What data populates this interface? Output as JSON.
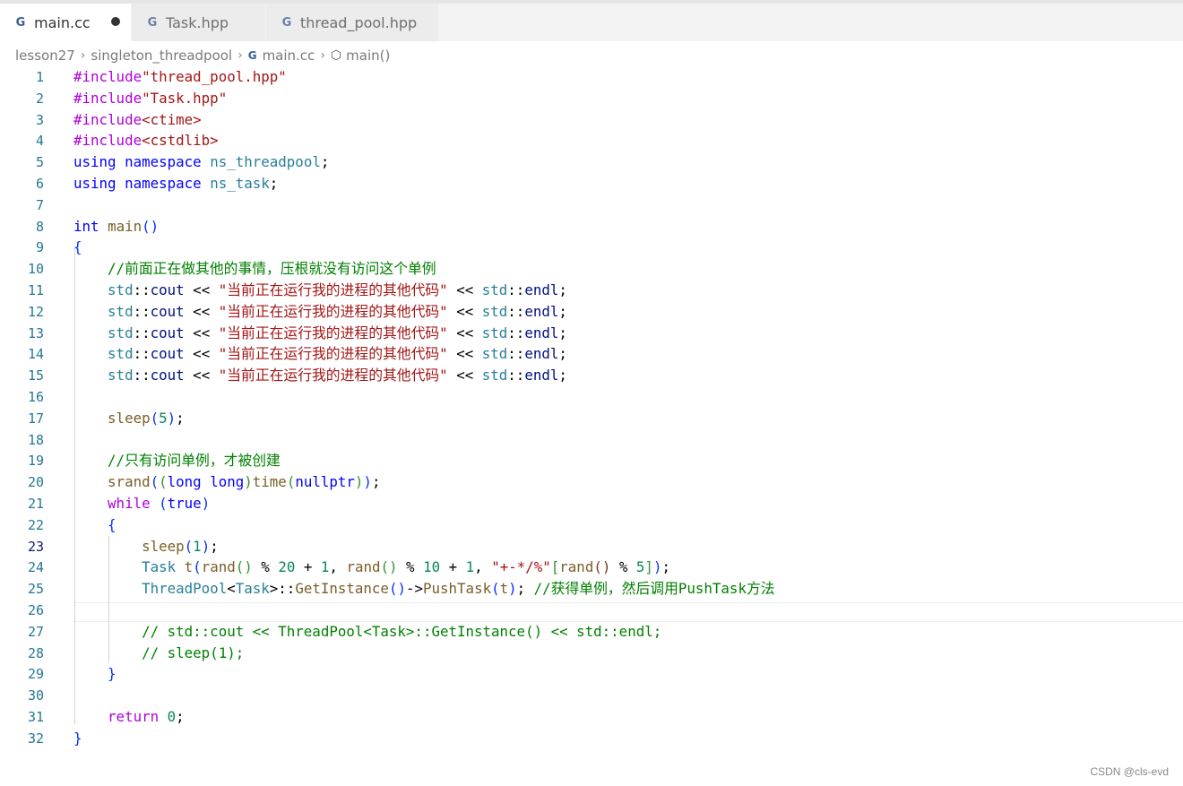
{
  "tabs": [
    {
      "label": "main.cc",
      "active": true,
      "modified": true,
      "icon": "cpp-file-icon"
    },
    {
      "label": "Task.hpp",
      "active": false,
      "modified": false,
      "icon": "cpp-file-icon"
    },
    {
      "label": "thread_pool.hpp",
      "active": false,
      "modified": false,
      "icon": "cpp-file-icon"
    }
  ],
  "breadcrumb": {
    "items": [
      "lesson27",
      "singleton_threadpool",
      "main.cc",
      "main()"
    ],
    "file_icon": "C",
    "symbol_icon": "cube-icon"
  },
  "editor": {
    "current_line": 23,
    "lines": [
      {
        "n": "1",
        "text": "#include\"thread_pool.hpp\""
      },
      {
        "n": "2",
        "text": "#include\"Task.hpp\""
      },
      {
        "n": "3",
        "text": "#include<ctime>"
      },
      {
        "n": "4",
        "text": "#include<cstdlib>"
      },
      {
        "n": "5",
        "text": "using namespace ns_threadpool;"
      },
      {
        "n": "6",
        "text": "using namespace ns_task;"
      },
      {
        "n": "7",
        "text": ""
      },
      {
        "n": "8",
        "text": "int main()"
      },
      {
        "n": "9",
        "text": "{"
      },
      {
        "n": "10",
        "text": "    //前面正在做其他的事情，压根就没有访问这个单例"
      },
      {
        "n": "11",
        "text": "    std::cout << \"当前正在运行我的进程的其他代码\" << std::endl;"
      },
      {
        "n": "12",
        "text": "    std::cout << \"当前正在运行我的进程的其他代码\" << std::endl;"
      },
      {
        "n": "13",
        "text": "    std::cout << \"当前正在运行我的进程的其他代码\" << std::endl;"
      },
      {
        "n": "14",
        "text": "    std::cout << \"当前正在运行我的进程的其他代码\" << std::endl;"
      },
      {
        "n": "15",
        "text": "    std::cout << \"当前正在运行我的进程的其他代码\" << std::endl;"
      },
      {
        "n": "16",
        "text": ""
      },
      {
        "n": "17",
        "text": "    sleep(5);"
      },
      {
        "n": "18",
        "text": ""
      },
      {
        "n": "19",
        "text": "    //只有访问单例，才被创建"
      },
      {
        "n": "20",
        "text": "    srand((long long)time(nullptr));"
      },
      {
        "n": "21",
        "text": "    while (true)"
      },
      {
        "n": "22",
        "text": "    {"
      },
      {
        "n": "23",
        "text": "        sleep(1);"
      },
      {
        "n": "24",
        "text": "        Task t(rand() % 20 + 1, rand() % 10 + 1, \"+-*/%\"[rand() % 5]);"
      },
      {
        "n": "25",
        "text": "        ThreadPool<Task>::GetInstance()->PushTask(t); //获得单例，然后调用PushTask方法"
      },
      {
        "n": "26",
        "text": ""
      },
      {
        "n": "27",
        "text": "        // std::cout << ThreadPool<Task>::GetInstance() << std::endl;"
      },
      {
        "n": "28",
        "text": "        // sleep(1);"
      },
      {
        "n": "29",
        "text": "    }"
      },
      {
        "n": "30",
        "text": ""
      },
      {
        "n": "31",
        "text": "    return 0;"
      },
      {
        "n": "32",
        "text": "}"
      }
    ]
  },
  "watermark": "CSDN @cls-evd"
}
